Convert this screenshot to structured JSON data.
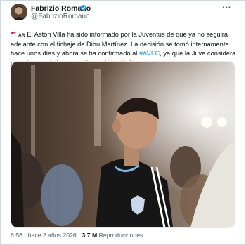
{
  "author": {
    "name": "Fabrizio Romano",
    "handle": "@FabrizioRomano",
    "verified": true,
    "avatar_icon": "avatar-photo"
  },
  "more_label": "···",
  "tweet": {
    "flag_icon": "argentina-flag-icon",
    "country_code": "AR",
    "part1": "El Aston Villa ha sido informado por la Juventus de que ya no seguirá adelante con el fichaje de Dibu Martínez. La decisión se tomó internamente hace unos días y ahora se ha confirmado al ",
    "hashtag": "#AVFC",
    "part2": ", ya que la Juve considera que el coste de la operación es demasiado elevado."
  },
  "meta": {
    "time": "6:56",
    "sep1": " · ",
    "age": "hace 2 años 2026",
    "sep2": " · ",
    "views_count": "3,7 M",
    "views_label": " Reproducciones"
  },
  "colors": {
    "link": "#1d9bf0",
    "secondary_text": "#536471",
    "verified": "#1d9bf0"
  }
}
